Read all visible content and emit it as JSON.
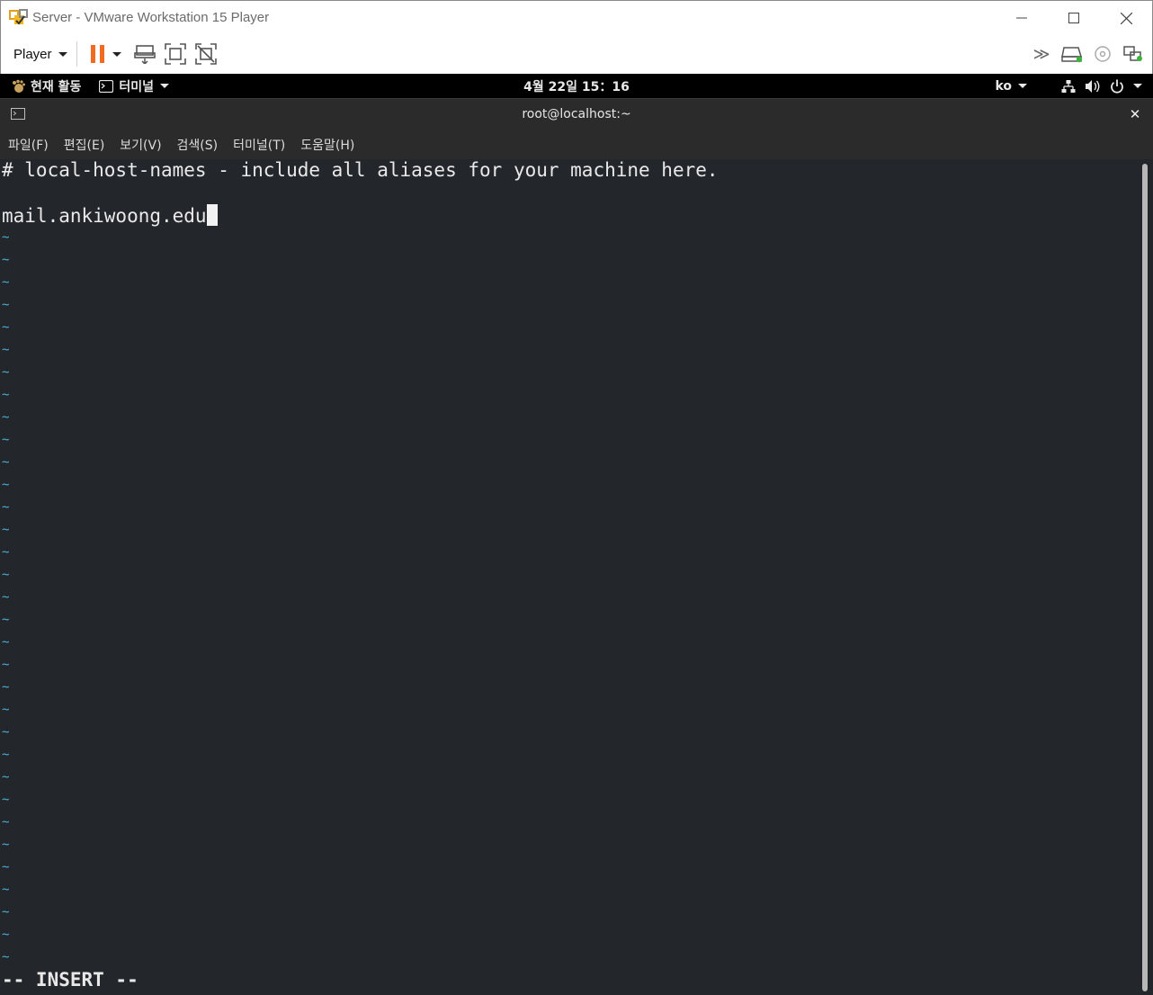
{
  "window": {
    "title": "Server - VMware Workstation 15 Player"
  },
  "toolbar": {
    "player_label": "Player",
    "pause_color": "#f26a21"
  },
  "gnome": {
    "activities_label": "현재 활동",
    "app_label": "터미널",
    "clock": "4월 22일  15：16",
    "language": "ko"
  },
  "terminal": {
    "title": "root@localhost:~",
    "menu": [
      "파일(F)",
      "편집(E)",
      "보기(V)",
      "검색(S)",
      "터미널(T)",
      "도움말(H)"
    ],
    "lines": [
      "# local-host-names - include all aliases for your machine here.",
      "",
      "mail.ankiwoong.edu"
    ],
    "tilde": "~",
    "tilde_count": 33,
    "mode": "-- INSERT --"
  }
}
